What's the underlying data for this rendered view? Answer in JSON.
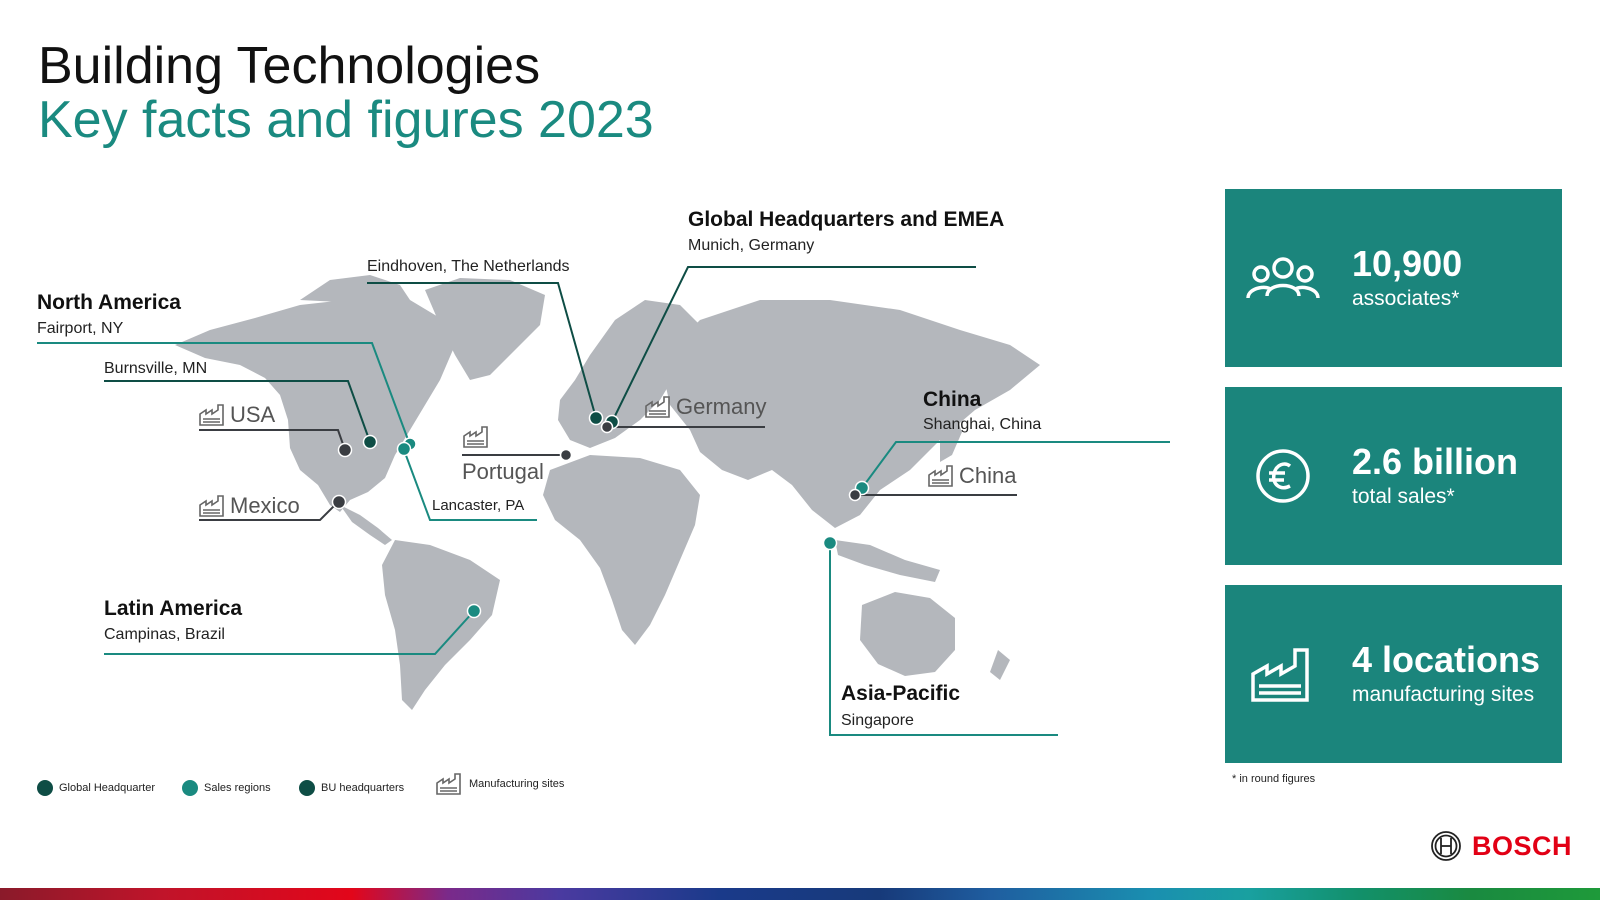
{
  "header": {
    "title": "Building Technologies",
    "subtitle": "Key facts and figures 2023"
  },
  "regions": {
    "global_hq": {
      "title": "Global Headquarters and EMEA",
      "city": "Munich, Germany"
    },
    "north_america": {
      "title": "North America",
      "city": "Fairport, NY"
    },
    "latin_america": {
      "title": "Latin America",
      "city": "Campinas, Brazil"
    },
    "china": {
      "title": "China",
      "city": "Shanghai, China"
    },
    "asia_pacific": {
      "title": "Asia-Pacific",
      "city": "Singapore"
    }
  },
  "locations": {
    "eindhoven": "Eindhoven, The Netherlands",
    "burnsville": "Burnsville, MN",
    "lancaster": "Lancaster, PA"
  },
  "manufacturing_sites": [
    "USA",
    "Mexico",
    "Portugal",
    "Germany",
    "China"
  ],
  "facts": [
    {
      "icon": "people-icon",
      "value": "10,900",
      "caption": "associates*"
    },
    {
      "icon": "euro-icon",
      "value": "2.6 billion",
      "caption": "total sales*"
    },
    {
      "icon": "factory-icon",
      "value": "4 locations",
      "caption": "manufacturing sites"
    }
  ],
  "footnote": "* in round figures",
  "legend": {
    "global_hq": "Global Headquarter",
    "sales_regions": "Sales regions",
    "bu_hq": "BU headquarters",
    "manufacturing": "Manufacturing sites"
  },
  "brand": {
    "name": "BOSCH"
  },
  "colors": {
    "accent": "#1a8a80",
    "card": "#1b857c",
    "map": "#b4b7bc",
    "dot_dark": "#0e4d45",
    "dot_sales": "#1a8a80",
    "dot_mfg": "#3a3d42",
    "brand_red": "#e20015"
  }
}
